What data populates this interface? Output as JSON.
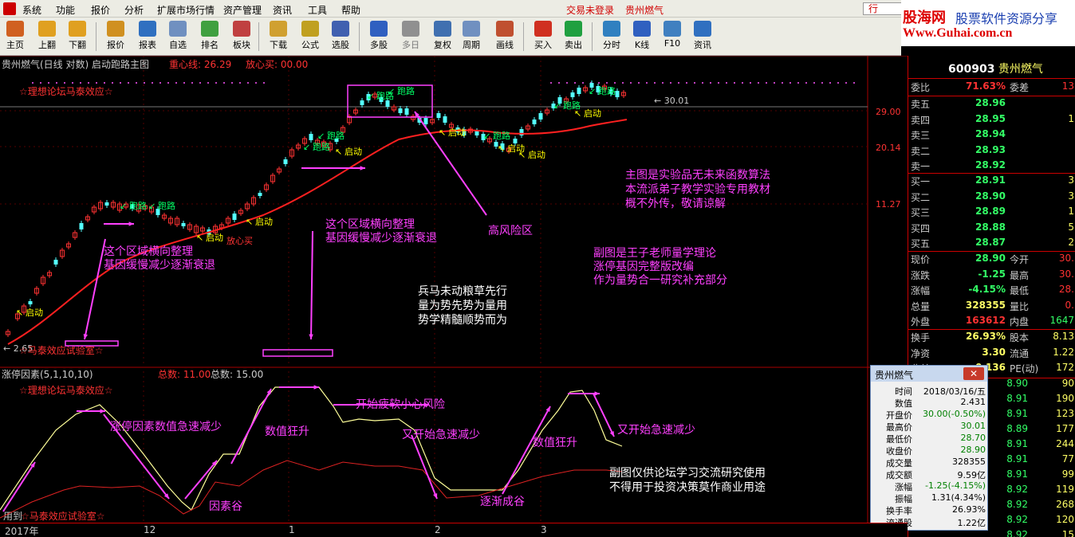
{
  "menubar": {
    "items": [
      "系统",
      "功能",
      "报价",
      "分析",
      "扩展市场行情",
      "资产管理",
      "资讯",
      "工具",
      "帮助"
    ],
    "trade_status": "交易未登录",
    "stock_title": "贵州燃气",
    "hangqing_tab": "行"
  },
  "brand": {
    "name": "股海网",
    "tagline": "股票软件资源分享",
    "url": "Www.Guhai.com.cn"
  },
  "toolbar": {
    "buttons": [
      {
        "label": "主页",
        "icon": "home-icon",
        "color": "#d06020"
      },
      {
        "label": "上翻",
        "icon": "arrow-up-icon",
        "color": "#e0a020"
      },
      {
        "label": "下翻",
        "icon": "arrow-down-icon",
        "color": "#e0a020"
      },
      {
        "label": "报价",
        "icon": "price-icon",
        "color": "#d09020"
      },
      {
        "label": "报表",
        "icon": "report-icon",
        "color": "#3070c0"
      },
      {
        "label": "自选",
        "icon": "f6-icon",
        "color": "#7090c0"
      },
      {
        "label": "排名",
        "icon": "rank-icon",
        "color": "#40a040"
      },
      {
        "label": "板块",
        "icon": "sector-icon",
        "color": "#c04040"
      },
      {
        "label": "下载",
        "icon": "download-icon",
        "color": "#d0a030"
      },
      {
        "label": "公式",
        "icon": "formula-icon",
        "color": "#c0a020"
      },
      {
        "label": "选股",
        "icon": "stock-pick-icon",
        "color": "#4060b0"
      },
      {
        "label": "多股",
        "icon": "multi-stock-icon",
        "color": "#3060c0"
      },
      {
        "label": "多日",
        "icon": "multi-day-icon",
        "color": "#909090"
      },
      {
        "label": "复权",
        "icon": "adjust-icon",
        "color": "#4070b0"
      },
      {
        "label": "周期",
        "icon": "f8-icon",
        "color": "#7090c0"
      },
      {
        "label": "画线",
        "icon": "draw-line-icon",
        "color": "#c05030"
      },
      {
        "label": "买入",
        "icon": "buy-icon",
        "color": "#d03020"
      },
      {
        "label": "卖出",
        "icon": "sell-icon",
        "color": "#20a040"
      },
      {
        "label": "分时",
        "icon": "intraday-icon",
        "color": "#3080c0"
      },
      {
        "label": "K线",
        "icon": "kline-icon",
        "color": "#3060c0"
      },
      {
        "label": "F10",
        "icon": "f10-icon",
        "color": "#4080c0"
      },
      {
        "label": "资讯",
        "icon": "news-icon",
        "color": "#3070c0"
      }
    ]
  },
  "main_chart": {
    "title": "贵州燃气(日线 对数) 启动跑路主图",
    "center_line_label": "重心线: 26.29",
    "release_label": "放心买: 00.00",
    "price_ticks": [
      "29.00",
      "20.14",
      "11.27"
    ],
    "high_label": "30.01",
    "low_label": "2.65",
    "watermark_top": "☆理想论坛马泰效应☆",
    "watermark_bottom": "☆马泰效应试验室☆",
    "signal_start": "启动",
    "signal_run": "跑路",
    "signal_buy": "放心买",
    "notes": {
      "consolidation_1": [
        "这个区域横向整理",
        "基因缓慢减少逐渐衰退"
      ],
      "consolidation_2": [
        "这个区域横向整理",
        "基因缓慢减少逐渐衰退"
      ],
      "high_risk": "高风险区",
      "army": [
        "兵马未动粮草先行",
        "量为势先势为量用",
        "势学精髓顺势而为"
      ],
      "main_desc": [
        "主图是实验品无未来函数算法",
        "本流派弟子教学实验专用教材",
        "概不外传，敬请谅解"
      ],
      "sub_desc": [
        "副图是王子老师量学理论",
        "涨停基因完整版改编",
        "作为量势合一研究补充部分"
      ]
    }
  },
  "sub_chart": {
    "title": "涨停因素(5,1,10,10)",
    "total_label": "总数: 11.00",
    "total_label2": "总数: 15.00",
    "watermark_top": "☆理想论坛马泰效应☆",
    "watermark_bottom": "☆马泰效应试验室☆",
    "prefix": "用到",
    "notes": {
      "n1": "涨停因素数值急速减少",
      "n2": "数值狂升",
      "n3": "开始疲软小心风险",
      "n4": "又开始急速减少",
      "n5": "数值狂升",
      "n6": "又开始急速减少",
      "n7": "因素谷",
      "n8": "逐渐成谷",
      "disclaimer": [
        "副图仅供论坛学习交流研究使用",
        "不得用于投资决策莫作商业用途"
      ]
    }
  },
  "timeline": {
    "labels": [
      {
        "text": "2017年"
      },
      {
        "text": "12"
      },
      {
        "text": "1"
      },
      {
        "text": "2"
      },
      {
        "text": "3"
      }
    ]
  },
  "quote": {
    "code": "600903",
    "name": "贵州燃气",
    "weibi_label": "委比",
    "weibi": "71.63%",
    "weicha_label": "委差",
    "weicha": "13",
    "sell": [
      {
        "label": "卖五",
        "price": "28.96",
        "vol": ""
      },
      {
        "label": "卖四",
        "price": "28.95",
        "vol": "1"
      },
      {
        "label": "卖三",
        "price": "28.94",
        "vol": ""
      },
      {
        "label": "卖二",
        "price": "28.93",
        "vol": ""
      },
      {
        "label": "卖一",
        "price": "28.92",
        "vol": ""
      }
    ],
    "buy": [
      {
        "label": "买一",
        "price": "28.91",
        "vol": "3"
      },
      {
        "label": "买二",
        "price": "28.90",
        "vol": "3"
      },
      {
        "label": "买三",
        "price": "28.89",
        "vol": "1"
      },
      {
        "label": "买四",
        "price": "28.88",
        "vol": "5"
      },
      {
        "label": "买五",
        "price": "28.87",
        "vol": "2"
      }
    ],
    "stats": [
      {
        "l": "现价",
        "v": "28.90",
        "l2": "今开",
        "v2": "30."
      },
      {
        "l": "涨跌",
        "v": "-1.25",
        "l2": "最高",
        "v2": "30."
      },
      {
        "l": "涨幅",
        "v": "-4.15%",
        "l2": "最低",
        "v2": "28."
      },
      {
        "l": "总量",
        "v": "328355",
        "l2": "量比",
        "v2": "0."
      },
      {
        "l": "外盘",
        "v": "163612",
        "l2": "内盘",
        "v2": "1647"
      }
    ],
    "stats2": [
      {
        "l": "换手",
        "v": "26.93%",
        "l2": "股本",
        "v2": "8.13"
      },
      {
        "l": "净资",
        "v": "3.30",
        "l2": "流通",
        "v2": "1.22"
      },
      {
        "l": "收益",
        "v": "0.136",
        "l2": "PE(动)",
        "v2": "172"
      }
    ],
    "ticks": [
      {
        "p": "8.90",
        "v": "90"
      },
      {
        "p": "8.91",
        "v": "190"
      },
      {
        "p": "8.91",
        "v": "123"
      },
      {
        "p": "8.89",
        "v": "177"
      },
      {
        "p": "8.91",
        "v": "244"
      },
      {
        "p": "8.91",
        "v": "77"
      },
      {
        "p": "8.91",
        "v": "99"
      },
      {
        "p": "8.92",
        "v": "119"
      },
      {
        "p": "8.92",
        "v": "268"
      },
      {
        "p": "8.92",
        "v": "120"
      },
      {
        "p": "8.92",
        "v": "15"
      }
    ]
  },
  "popup": {
    "title": "贵州燃气",
    "close": "✕",
    "rows": [
      {
        "l": "时间",
        "v": "2018/03/16/五",
        "green": false
      },
      {
        "l": "数值",
        "v": "2.431",
        "green": false
      },
      {
        "l": "开盘价",
        "v": "30.00(-0.50%)",
        "green": true
      },
      {
        "l": "最高价",
        "v": "30.01",
        "green": true
      },
      {
        "l": "最低价",
        "v": "28.70",
        "green": true
      },
      {
        "l": "收盘价",
        "v": "28.90",
        "green": true
      },
      {
        "l": "成交量",
        "v": "328355",
        "green": false
      },
      {
        "l": "成交额",
        "v": "9.59亿",
        "green": false
      },
      {
        "l": "涨幅",
        "v": "-1.25(-4.15%)",
        "green": true
      },
      {
        "l": "振幅",
        "v": "1.31(4.34%)",
        "green": false
      },
      {
        "l": "换手率",
        "v": "26.93%",
        "green": false
      },
      {
        "l": "流通股",
        "v": "1.22亿",
        "green": false
      }
    ]
  },
  "colors": {
    "up": "#ff3232",
    "down": "#54ffff",
    "ma": "#ff2020",
    "signal": "#ffff00",
    "annotation": "#ff40ff",
    "line_white": "#ffff99"
  }
}
